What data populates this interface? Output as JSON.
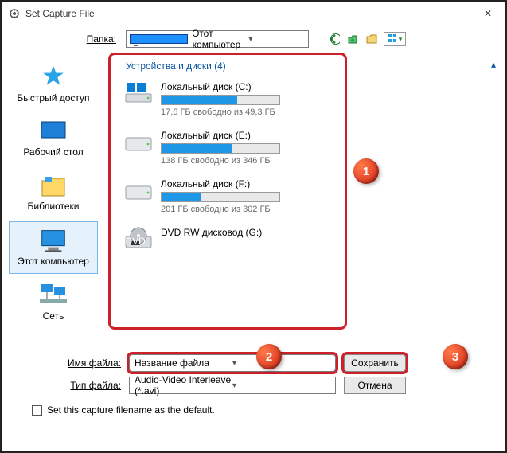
{
  "window": {
    "title": "Set Capture File"
  },
  "nav": {
    "folder_label": "Папка:",
    "current_folder": "Этот компьютер"
  },
  "places": [
    {
      "id": "quick",
      "label": "Быстрый доступ"
    },
    {
      "id": "desktop",
      "label": "Рабочий стол"
    },
    {
      "id": "libraries",
      "label": "Библиотеки"
    },
    {
      "id": "this-pc",
      "label": "Этот компьютер",
      "selected": true
    },
    {
      "id": "network",
      "label": "Сеть"
    }
  ],
  "group_header": "Устройства и диски (4)",
  "drives": [
    {
      "name": "Локальный диск (C:)",
      "free": "17,6 ГБ свободно из 49,3 ГБ",
      "fill_pct": 64,
      "kind": "hdd-win"
    },
    {
      "name": "Локальный диск (E:)",
      "free": "138 ГБ свободно из 346 ГБ",
      "fill_pct": 60,
      "kind": "hdd"
    },
    {
      "name": "Локальный диск (F:)",
      "free": "201 ГБ свободно из 302 ГБ",
      "fill_pct": 33,
      "kind": "hdd"
    },
    {
      "name": "DVD RW дисковод (G:)",
      "free": "",
      "fill_pct": 0,
      "kind": "dvd"
    }
  ],
  "fields": {
    "name_label": "Имя файла:",
    "name_value": "Название файла",
    "type_label": "Тип файла:",
    "type_value": "Audio-Video Interleave (*.avi)",
    "save": "Сохранить",
    "cancel": "Отмена"
  },
  "footer": {
    "set_default": "Set this capture filename as the default."
  },
  "callouts": {
    "c1": "1",
    "c2": "2",
    "c3": "3"
  }
}
